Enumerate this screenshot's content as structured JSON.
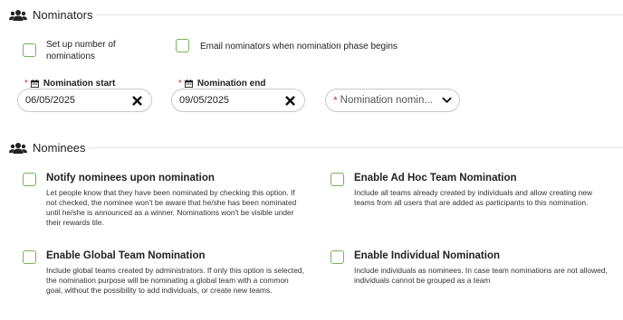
{
  "nominators": {
    "title": "Nominators",
    "icon": "users-icon",
    "set_up_number": "Set up number of nominations",
    "email_nominators": "Email nominators when nomination phase begins",
    "nomination_start": {
      "label": "Nomination start",
      "value": "06/05/2025"
    },
    "nomination_end": {
      "label": "Nomination end",
      "value": "09/05/2025"
    },
    "nomination_select": {
      "placeholder": "Nomination nomin..."
    }
  },
  "nominees": {
    "title": "Nominees",
    "icon": "users-icon",
    "options": [
      {
        "title": "Notify nominees upon nomination",
        "desc": "Let people know that they have been nominated by checking this option. If not checked, the nominee won't be aware that he/she has been nominated until he/she is announced as a winner. Nominations won't be visible under their rewards tile."
      },
      {
        "title": "Enable Ad Hoc Team Nomination",
        "desc": "Include all teams already created by individuals and allow creating new teams from all users that are added as participants to this nomination."
      },
      {
        "title": "Enable Global Team Nomination",
        "desc": "Include global teams created by administrators. If only this option is selected, the nomination purpose will be nominating a global team with a common goal, without the possibility to add individuals, or create new teams."
      },
      {
        "title": "Enable Individual Nomination",
        "desc": "Include individuals as nominees. In case team nominations are not allowed, individuals cannot be grouped as a team"
      }
    ]
  },
  "colors": {
    "checkbox_border": "#74b35a",
    "required": "#d32f2f",
    "divider": "#e3e3e3"
  }
}
